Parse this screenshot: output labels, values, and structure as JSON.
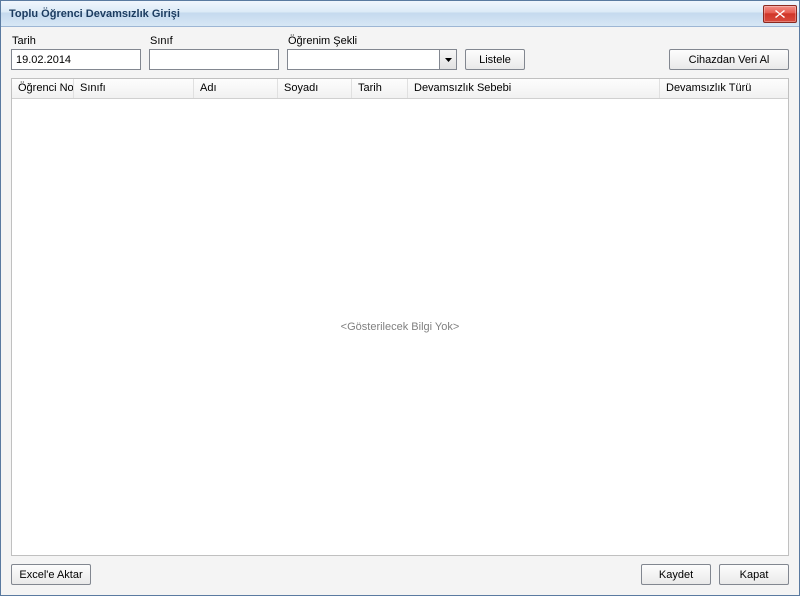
{
  "window": {
    "title": "Toplu Öğrenci Devamsızlık Girişi"
  },
  "filters": {
    "date": {
      "label": "Tarih",
      "value": "19.02.2014"
    },
    "class": {
      "label": "Sınıf",
      "value": ""
    },
    "education_type": {
      "label": "Öğrenim Şekli",
      "value": ""
    },
    "list_button": "Listele",
    "device_button": "Cihazdan Veri Al"
  },
  "grid": {
    "columns": {
      "student_no": "Öğrenci No",
      "class": "Sınıfı",
      "first_name": "Adı",
      "last_name": "Soyadı",
      "date": "Tarih",
      "absence_reason": "Devamsızlık Sebebi",
      "absence_type": "Devamsızlık Türü"
    },
    "empty_text": "<Gösterilecek Bilgi Yok>"
  },
  "footer": {
    "export": "Excel'e Aktar",
    "save": "Kaydet",
    "close": "Kapat"
  }
}
